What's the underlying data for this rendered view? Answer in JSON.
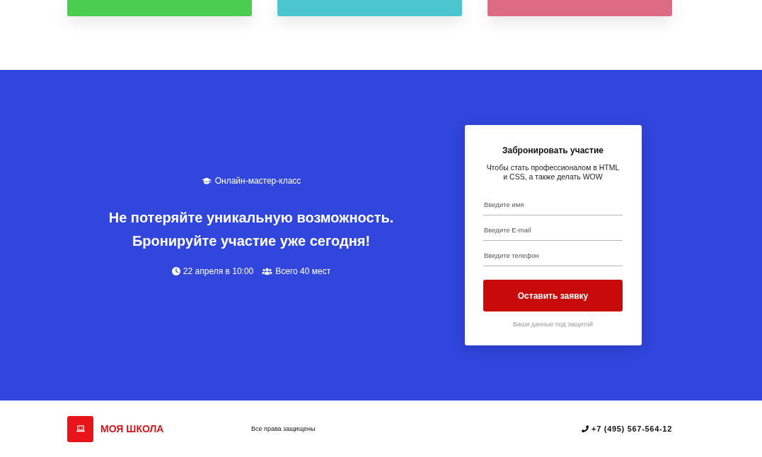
{
  "cards": [
    {
      "color": "#4bce4f"
    },
    {
      "color": "#4bc6cf"
    },
    {
      "color": "#dd6b84"
    }
  ],
  "promo": {
    "badge": "Онлайн-мастер-класс",
    "headline": [
      "Не потеряйте уникальную возможность.",
      "Бронируйте участие уже сегодня!"
    ],
    "meta": [
      {
        "kind": "date",
        "text": "22 апреля в 10:00"
      },
      {
        "kind": "seats",
        "text": "Всего 40 мест"
      }
    ]
  },
  "form": {
    "title": "Забронировать участие",
    "subtitle": "Чтобы стать профессионалом в HTML и CSS, а также делать WOW",
    "fields": [
      {
        "placeholder": "Введите имя"
      },
      {
        "placeholder": "Введите E-mail"
      },
      {
        "placeholder": "Введите телефон"
      }
    ],
    "submit": "Оставить заявку",
    "note": "Ваши данные под защитой"
  },
  "footer": {
    "logo_text": "МОЯ ШКОЛА",
    "copyright": "Все права защищены",
    "phone": "+7 (495) 567-564-12"
  }
}
